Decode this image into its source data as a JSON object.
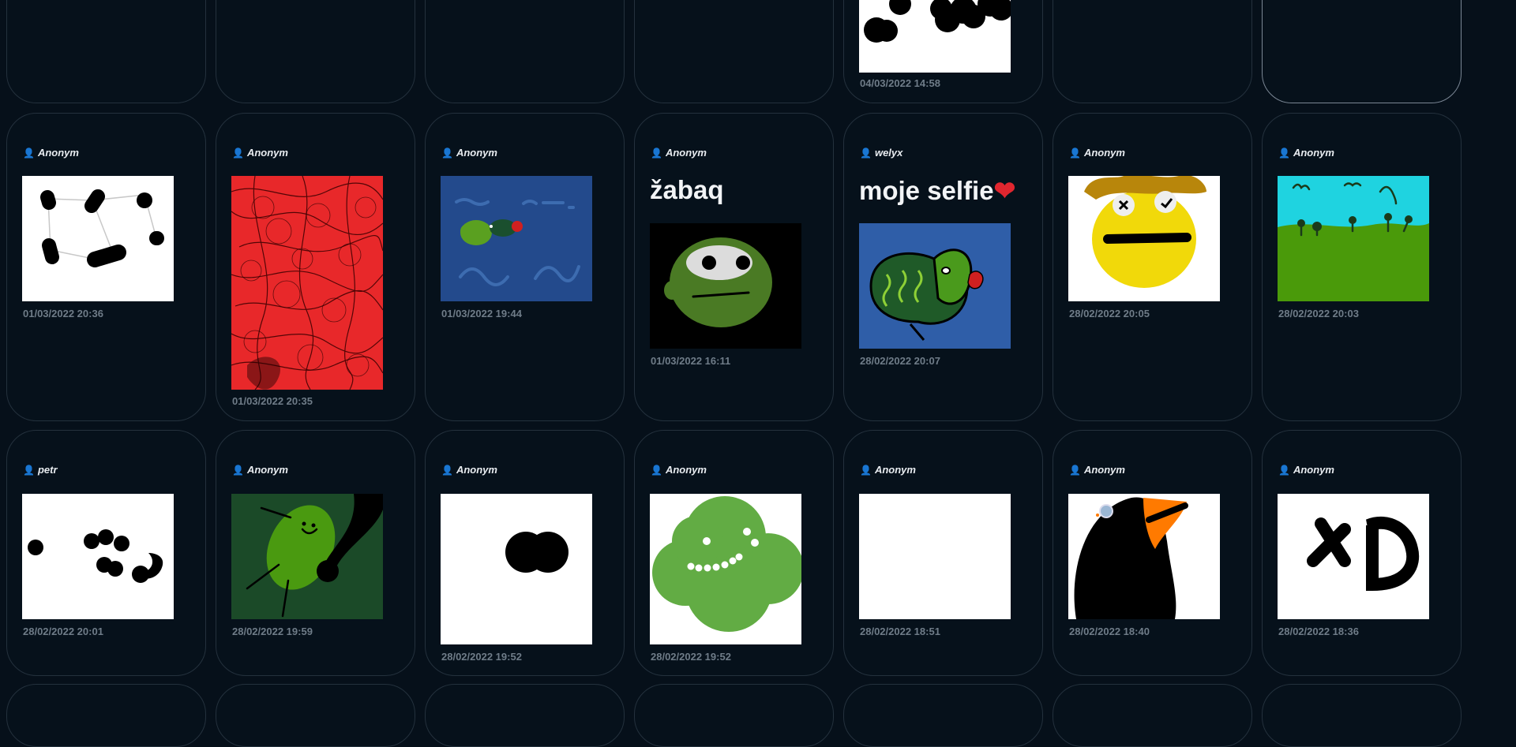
{
  "icons": {
    "author_icon": "user-icon"
  },
  "colors": {
    "background": "#06101a",
    "card_border": "#24313d",
    "date": "#6f7c88"
  },
  "top_row": [
    {
      "date": ""
    },
    {
      "date": ""
    },
    {
      "date": ""
    },
    {
      "date": ""
    },
    {
      "date": "04/03/2022 14:58"
    },
    {
      "date": ""
    },
    {
      "date": ""
    }
  ],
  "row2": [
    {
      "author": "Anonym",
      "title": "",
      "date": "01/03/2022 20:36"
    },
    {
      "author": "Anonym",
      "title": "",
      "date": "01/03/2022 20:35"
    },
    {
      "author": "Anonym",
      "title": "",
      "date": "01/03/2022 19:44"
    },
    {
      "author": "Anonym",
      "title": "žabaq",
      "date": "01/03/2022 16:11"
    },
    {
      "author": "welyx",
      "title": "moje selfie",
      "title_suffix": "❤",
      "date": "28/02/2022 20:07"
    },
    {
      "author": "Anonym",
      "title": "",
      "date": "28/02/2022 20:05"
    },
    {
      "author": "Anonym",
      "title": "",
      "date": "28/02/2022 20:03"
    }
  ],
  "row3": [
    {
      "author": "petr",
      "date": "28/02/2022 20:01"
    },
    {
      "author": "Anonym",
      "date": "28/02/2022 19:59"
    },
    {
      "author": "Anonym",
      "date": "28/02/2022 19:52"
    },
    {
      "author": "Anonym",
      "date": "28/02/2022 19:52"
    },
    {
      "author": "Anonym",
      "date": "28/02/2022 18:51"
    },
    {
      "author": "Anonym",
      "date": "28/02/2022 18:40"
    },
    {
      "author": "Anonym",
      "date": "28/02/2022 18:36"
    }
  ]
}
